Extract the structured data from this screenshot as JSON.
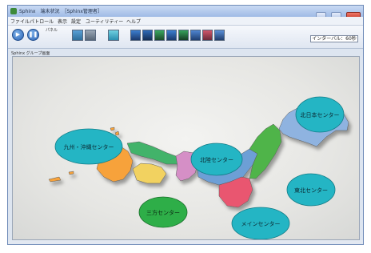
{
  "window": {
    "title": "Sphinx　端末状況　［Sphinx管理者］",
    "controls": [
      "minimize-button",
      "maximize-button",
      "close-button"
    ]
  },
  "menu": [
    "ファイル",
    "パトロール",
    "表示",
    "設定",
    "ユーティリティー",
    "ヘルプ"
  ],
  "toolbar": {
    "play_icon": "play-icon",
    "pause_icon": "pause-icon",
    "panel_label": "パネル",
    "interval": "インターバル：60秒"
  },
  "panel_title": "Sphinx グループ画面",
  "colors": {
    "kyushu": "#f7a23a",
    "shikoku": "#f2d261",
    "chugoku": "#43b36a",
    "kansai": "#d58fc6",
    "chubu": "#6d9fd6",
    "kanto": "#e9566f",
    "tohoku": "#4fb449",
    "hokkaido": "#8fb3e0",
    "center_bubble": "#24b5c4",
    "center_bubble_green": "#2eae48"
  },
  "centers": [
    {
      "key": "kyushu_okinawa",
      "label": "九州・沖縄センター"
    },
    {
      "key": "kita_nihon",
      "label": "北日本センター"
    },
    {
      "key": "hokuriku",
      "label": "北陸センター"
    },
    {
      "key": "tohoku",
      "label": "東北センター"
    },
    {
      "key": "sanpo",
      "label": "三方センター"
    },
    {
      "key": "main",
      "label": "メインセンター"
    }
  ]
}
